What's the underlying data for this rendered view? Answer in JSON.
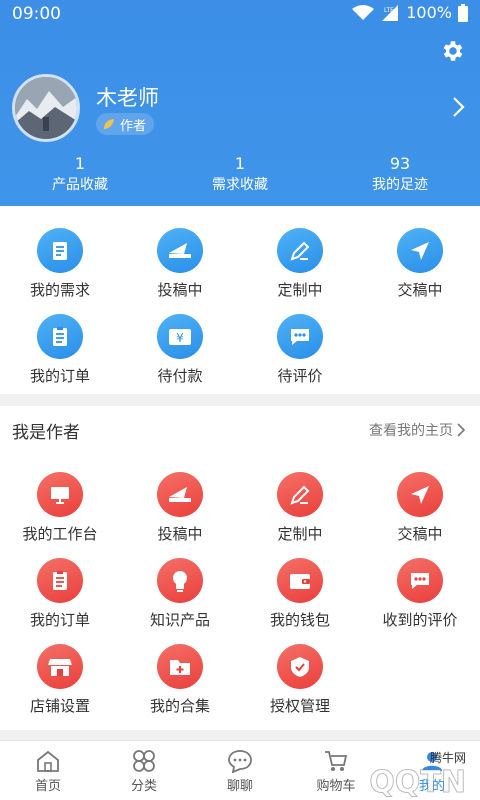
{
  "status_bar": {
    "time": "09:00",
    "network": "LTE",
    "battery": "100%"
  },
  "profile": {
    "name": "木老师",
    "role": "作者"
  },
  "stats": [
    {
      "value": "1",
      "label": "产品收藏"
    },
    {
      "value": "1",
      "label": "需求收藏"
    },
    {
      "value": "93",
      "label": "我的足迹"
    }
  ],
  "buyer_actions": [
    {
      "label": "我的需求",
      "icon": "document-icon"
    },
    {
      "label": "投稿中",
      "icon": "submit-envelope-icon"
    },
    {
      "label": "定制中",
      "icon": "pencil-icon"
    },
    {
      "label": "交稿中",
      "icon": "paper-plane-icon"
    },
    {
      "label": "我的订单",
      "icon": "order-list-icon"
    },
    {
      "label": "待付款",
      "icon": "yen-payment-icon"
    },
    {
      "label": "待评价",
      "icon": "chat-bubble-icon"
    }
  ],
  "author_section": {
    "title": "我是作者",
    "link": "查看我的主页",
    "actions": [
      {
        "label": "我的工作台",
        "icon": "workstation-icon"
      },
      {
        "label": "投稿中",
        "icon": "submit-envelope-icon"
      },
      {
        "label": "定制中",
        "icon": "pencil-icon"
      },
      {
        "label": "交稿中",
        "icon": "paper-plane-icon"
      },
      {
        "label": "我的订单",
        "icon": "order-list-icon"
      },
      {
        "label": "知识产品",
        "icon": "lightbulb-icon"
      },
      {
        "label": "我的钱包",
        "icon": "wallet-icon"
      },
      {
        "label": "收到的评价",
        "icon": "chat-bubble-icon"
      },
      {
        "label": "店铺设置",
        "icon": "shop-icon"
      },
      {
        "label": "我的合集",
        "icon": "folder-plus-icon"
      },
      {
        "label": "授权管理",
        "icon": "shield-check-icon"
      }
    ]
  },
  "bottom_nav": [
    {
      "label": "首页",
      "icon": "home-icon"
    },
    {
      "label": "分类",
      "icon": "category-icon"
    },
    {
      "label": "聊聊",
      "icon": "chat-icon"
    },
    {
      "label": "购物车",
      "icon": "cart-icon"
    },
    {
      "label": "我的",
      "icon": "profile-icon"
    }
  ],
  "watermark": "腾牛网",
  "colors": {
    "header": "#3c8ee6",
    "accent_blue": "#2a8fe8",
    "accent_red": "#ea3f3c"
  }
}
